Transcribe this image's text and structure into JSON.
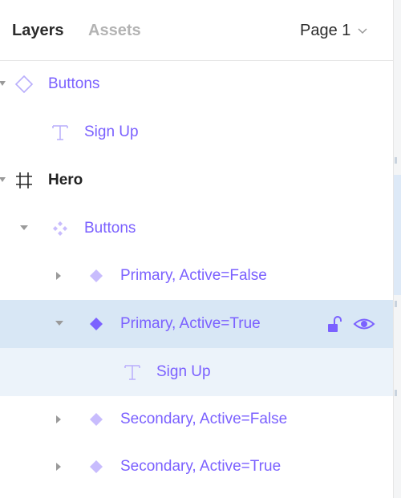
{
  "tabs": {
    "layers": "Layers",
    "assets": "Assets"
  },
  "page_selector": {
    "value": "Page 1"
  },
  "layers": [
    {
      "label": "Buttons",
      "icon": "component-outline-icon",
      "arrow": "expanded"
    },
    {
      "label": "Sign Up",
      "icon": "text-icon"
    },
    {
      "label": "Hero",
      "icon": "frame-icon",
      "arrow": "expanded"
    },
    {
      "label": "Buttons",
      "icon": "component-set-icon",
      "arrow": "expanded"
    },
    {
      "label": "Primary, Active=False",
      "icon": "instance-icon",
      "arrow": "collapsed"
    },
    {
      "label": "Primary, Active=True",
      "icon": "instance-icon",
      "arrow": "expanded",
      "selected": true
    },
    {
      "label": "Sign Up",
      "icon": "text-icon"
    },
    {
      "label": "Secondary, Active=False",
      "icon": "instance-icon",
      "arrow": "collapsed"
    },
    {
      "label": "Secondary, Active=True",
      "icon": "instance-icon",
      "arrow": "collapsed"
    }
  ],
  "colors": {
    "component": "#7b61ff",
    "selected_bg": "#d8e7f5",
    "child_selected_bg": "#ecf3fa"
  }
}
